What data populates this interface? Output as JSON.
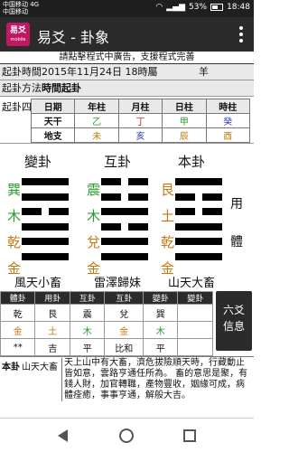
{
  "status": {
    "carrier1": "中国移动 4G",
    "carrier2": "中国移动",
    "battery": "53%",
    "time": "18:48"
  },
  "app": {
    "logo_line1": "易爻",
    "logo_line2": "mobile",
    "title": "易爻 - 卦象"
  },
  "ad": "請點擊程式中廣告，支援程式完善",
  "info": {
    "time_label": "起卦時間2015年11月24日 18時屬",
    "time_value": "羊",
    "method_label": "起卦方法",
    "method_value": "時間起卦"
  },
  "pillars": {
    "label": "起卦四柱",
    "headers": [
      "日期",
      "年柱",
      "月柱",
      "日柱",
      "時柱"
    ],
    "rows": [
      {
        "name": "天干",
        "cells": [
          {
            "t": "乙",
            "c": "#2e9a2e"
          },
          {
            "t": "丁",
            "c": "#d32a2a"
          },
          {
            "t": "甲",
            "c": "#2e9a2e"
          },
          {
            "t": "癸",
            "c": "#2b3cc7"
          }
        ]
      },
      {
        "name": "地支",
        "cells": [
          {
            "t": "未",
            "c": "#c07a12"
          },
          {
            "t": "亥",
            "c": "#2b3cc7"
          },
          {
            "t": "辰",
            "c": "#c07a12"
          },
          {
            "t": "酉",
            "c": "#c07a12"
          }
        ]
      }
    ]
  },
  "guas": [
    {
      "title": "變卦",
      "chars": [
        {
          "t": "巽",
          "c": "#2e9a2e"
        },
        {
          "t": "木",
          "c": "#2e9a2e"
        },
        {
          "t": "乾",
          "c": "#c07a12"
        },
        {
          "t": "金",
          "c": "#c07a12"
        }
      ],
      "lines": [
        1,
        1,
        0,
        1,
        1,
        1
      ],
      "name": "風天小畜"
    },
    {
      "title": "互卦",
      "chars": [
        {
          "t": "震",
          "c": "#2e9a2e"
        },
        {
          "t": "木",
          "c": "#2e9a2e"
        },
        {
          "t": "兌",
          "c": "#c07a12"
        },
        {
          "t": "金",
          "c": "#c07a12"
        }
      ],
      "lines": [
        0,
        0,
        1,
        0,
        1,
        1
      ],
      "name": "雷澤歸妹"
    },
    {
      "title": "本卦",
      "chars": [
        {
          "t": "艮",
          "c": "#c07a12"
        },
        {
          "t": "土",
          "c": "#c07a12"
        },
        {
          "t": "乾",
          "c": "#c07a12"
        },
        {
          "t": "金",
          "c": "#c07a12"
        }
      ],
      "lines": [
        1,
        0,
        0,
        1,
        1,
        1
      ],
      "name": "山天大畜"
    }
  ],
  "yong": "用",
  "ti": "體",
  "gtable": {
    "headers": [
      "體卦",
      "用卦",
      "互卦",
      "互卦",
      "變卦",
      "變卦"
    ],
    "rows": [
      [
        {
          "t": "乾",
          "c": "#111"
        },
        {
          "t": "艮",
          "c": "#111"
        },
        {
          "t": "震",
          "c": "#111"
        },
        {
          "t": "兌",
          "c": "#111"
        },
        {
          "t": "巽",
          "c": "#111"
        },
        {
          "t": "",
          "c": "#111"
        }
      ],
      [
        {
          "t": "金",
          "c": "#c07a12"
        },
        {
          "t": "土",
          "c": "#c07a12"
        },
        {
          "t": "木",
          "c": "#2e9a2e"
        },
        {
          "t": "金",
          "c": "#c07a12"
        },
        {
          "t": "木",
          "c": "#2e9a2e"
        },
        {
          "t": "",
          "c": "#111"
        }
      ],
      [
        {
          "t": "**",
          "c": "#111"
        },
        {
          "t": "吉",
          "c": "#111"
        },
        {
          "t": "平",
          "c": "#111"
        },
        {
          "t": "比和",
          "c": "#111"
        },
        {
          "t": "平",
          "c": "#111"
        },
        {
          "t": "",
          "c": "#111"
        }
      ]
    ]
  },
  "liuyao": {
    "line1": "六爻",
    "line2": "信息"
  },
  "bengua": {
    "label": "本卦",
    "name": "山天大畜",
    "text": "天上山中有大畜，濟危拔險順天時，行藏動止皆如意，雲路亨通任所為。 畜的意思是聚，有錢人財，加官轉職，產物豐收，姻緣可成，病體痊癒，事事亨通，解般大吉。"
  }
}
